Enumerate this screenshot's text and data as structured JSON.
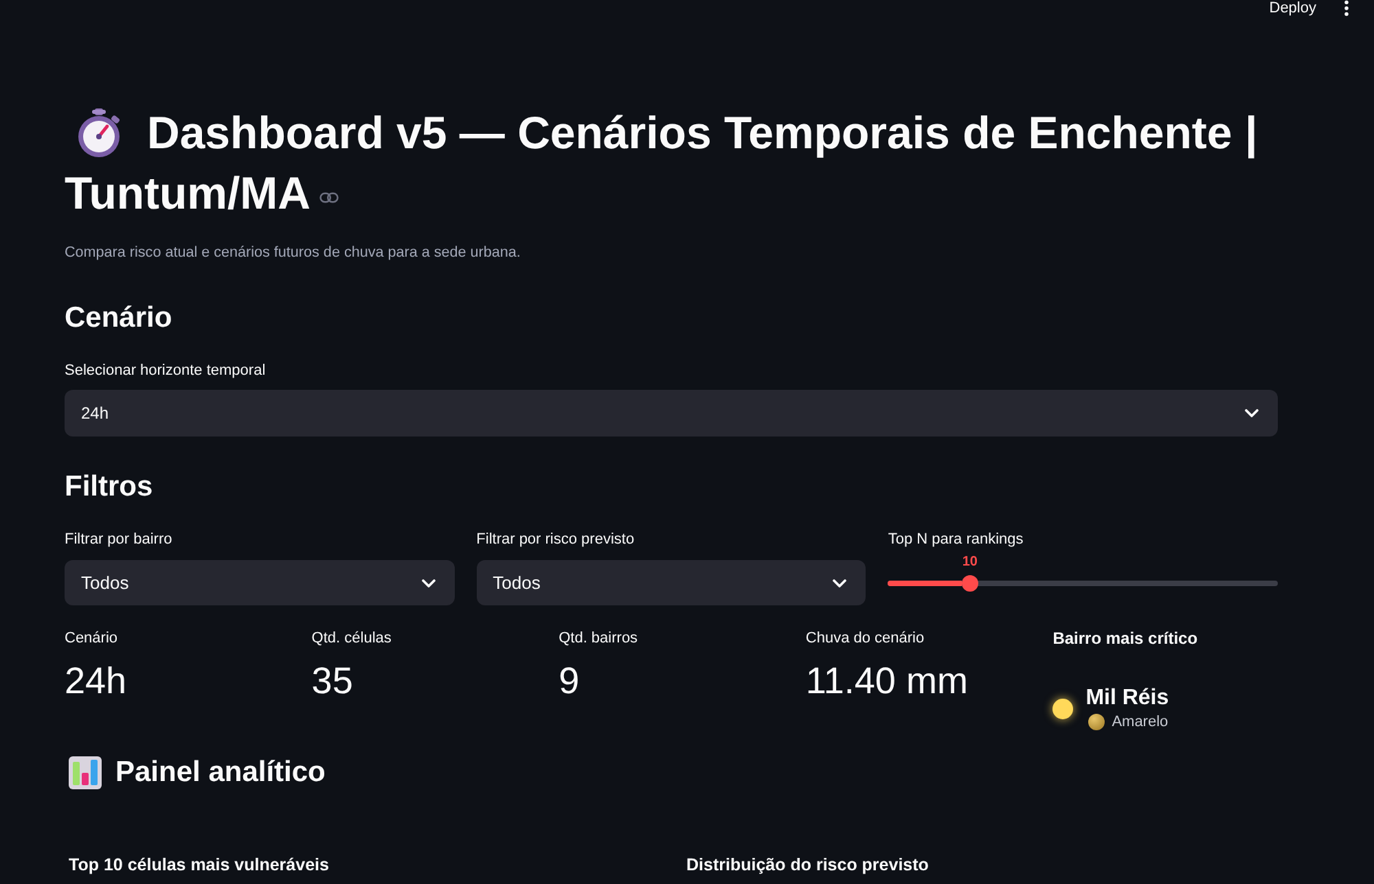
{
  "header": {
    "deploy": "Deploy"
  },
  "title_lines": [
    "Dashboard v5 — Cenários Temporais de Enchente |",
    "Tuntum/MA"
  ],
  "subtitle": "Compara risco atual e cenários futuros de chuva para a sede urbana.",
  "scenario_section": {
    "heading": "Cenário",
    "select": {
      "label": "Selecionar horizonte temporal",
      "value": "24h"
    }
  },
  "filters_section": {
    "heading": "Filtros",
    "filters": [
      {
        "kind": "select",
        "label": "Filtrar por bairro",
        "value": "Todos"
      },
      {
        "kind": "select",
        "label": "Filtrar por risco previsto",
        "value": "Todos"
      },
      {
        "kind": "slider",
        "label": "Top N para rankings",
        "value": "10",
        "level": 0.21
      }
    ]
  },
  "metrics": [
    {
      "kind": "metric",
      "label": "Cenário",
      "value": "24h"
    },
    {
      "kind": "metric",
      "label": "Qtd. células",
      "value": "35"
    },
    {
      "kind": "metric",
      "label": "Qtd. bairros",
      "value": "9"
    },
    {
      "kind": "metric",
      "label": "Chuva do cenário",
      "value": "11.40 mm"
    },
    {
      "kind": "highlight",
      "label": "Bairro mais crítico",
      "value": "Mil Réis",
      "status": "Amarelo",
      "color": "#ffd95a"
    }
  ],
  "analytics": {
    "heading": "Painel analítico",
    "subheadings": [
      "Top 10 células mais vulneráveis",
      "Distribuição do risco previsto"
    ]
  }
}
